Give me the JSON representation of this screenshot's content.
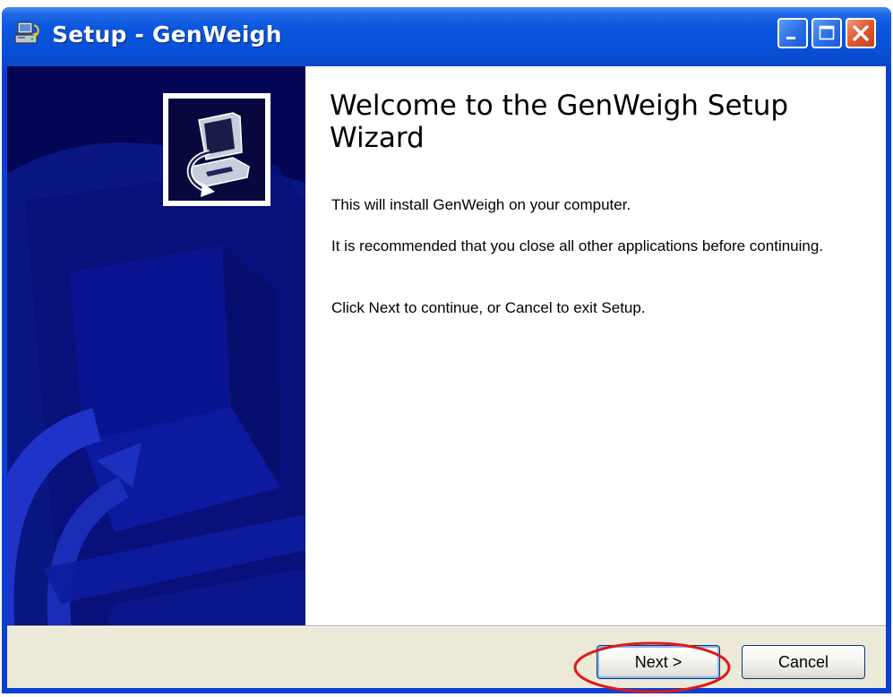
{
  "window": {
    "title": "Setup - GenWeigh",
    "icon": "setup-installer-icon",
    "controls": {
      "minimize_icon": "minimize-icon",
      "maximize_icon": "maximize-icon",
      "close_icon": "close-icon"
    }
  },
  "wizard": {
    "heading": "Welcome to the GenWeigh Setup Wizard",
    "paragraphs": [
      "This will install GenWeigh on your computer.",
      "It is recommended that you close all other applications before continuing.",
      "Click Next to continue, or Cancel to exit Setup."
    ],
    "side_graphic_icon": "computer-install-icon"
  },
  "buttons": {
    "next_label": "Next >",
    "cancel_label": "Cancel"
  },
  "colors": {
    "titlebar_blue": "#0850d8",
    "side_panel_navy": "#050555",
    "dialog_face": "#ece9d8",
    "close_button_red": "#e0562e",
    "annotation_red": "#e01818"
  }
}
